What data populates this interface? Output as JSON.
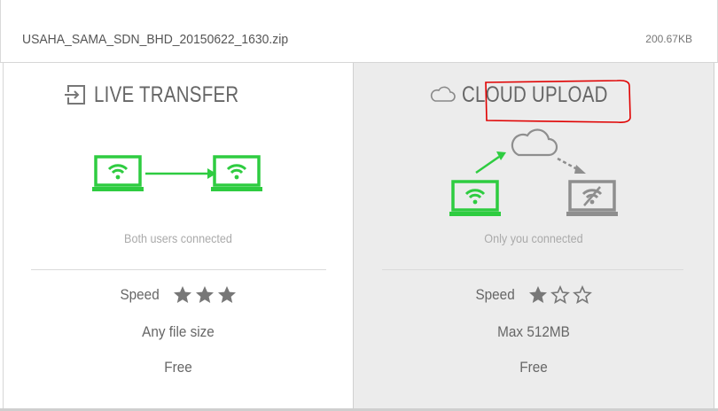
{
  "file": {
    "name": "USAHA_SAMA_SDN_BHD_20150622_1630.zip",
    "size": "200.67KB"
  },
  "live_transfer": {
    "title": "LIVE TRANSFER",
    "caption": "Both users connected",
    "speed_label": "Speed",
    "speed_rating": 3,
    "file_size_text": "Any file size",
    "price_text": "Free"
  },
  "cloud_upload": {
    "title": "CLOUD UPLOAD",
    "caption": "Only you connected",
    "speed_label": "Speed",
    "speed_rating": 1,
    "file_size_text": "Max 512MB",
    "price_text": "Free"
  },
  "colors": {
    "connected_green": "#2ecc40",
    "disconnected_gray": "#8e8e8e",
    "annotation_red": "#e00000"
  },
  "icons": {
    "live_title": "transfer-arrow-icon",
    "cloud_title": "cloud-icon",
    "laptop": "wifi-laptop-icon",
    "laptop_off": "wifi-off-laptop-icon",
    "star_filled": "star-filled-icon",
    "star_empty": "star-outline-icon"
  }
}
